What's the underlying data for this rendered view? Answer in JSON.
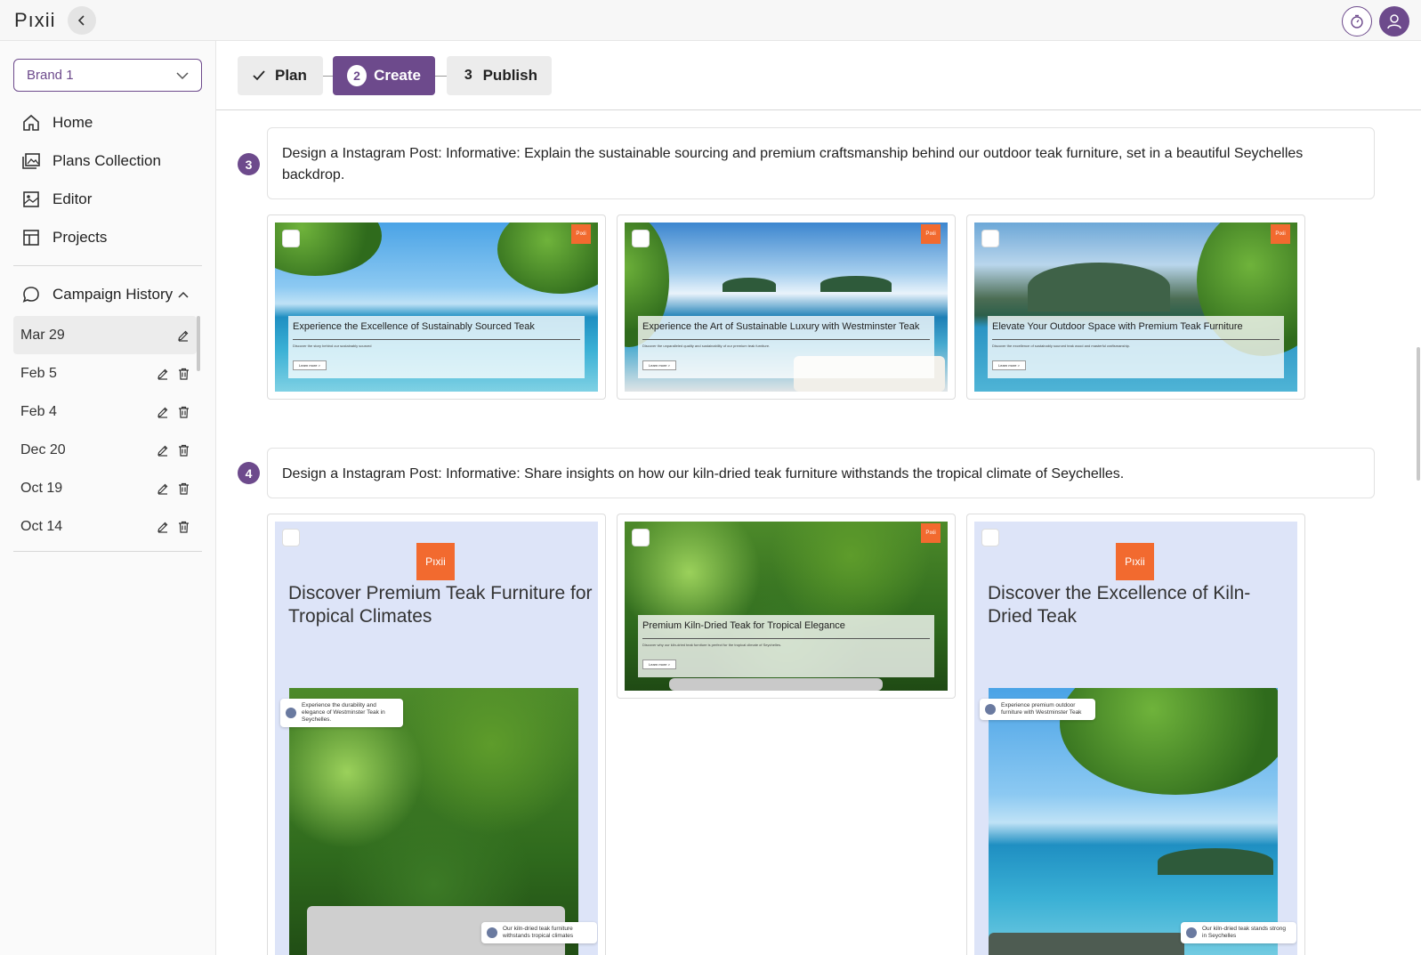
{
  "app": {
    "logo": "Pıxii"
  },
  "brand_select": {
    "value": "Brand 1"
  },
  "nav": [
    {
      "label": "Home",
      "icon": "home-icon"
    },
    {
      "label": "Plans Collection",
      "icon": "images-icon"
    },
    {
      "label": "Editor",
      "icon": "image-edit-icon"
    },
    {
      "label": "Projects",
      "icon": "layout-icon"
    }
  ],
  "history": {
    "title": "Campaign History",
    "items": [
      {
        "label": "Mar 29"
      },
      {
        "label": "Feb 5"
      },
      {
        "label": "Feb 4"
      },
      {
        "label": "Dec 20"
      },
      {
        "label": "Oct 19"
      },
      {
        "label": "Oct 14"
      }
    ]
  },
  "stepper": {
    "plan": "Plan",
    "create_num": "2",
    "create": "Create",
    "publish_num": "3",
    "publish": "Publish"
  },
  "rows": [
    {
      "num": "3",
      "prompt": "Design a Instagram Post: Informative: Explain the sustainable sourcing and premium craftsmanship behind our outdoor teak furniture, set in a beautiful Seychelles backdrop.",
      "cards": [
        {
          "tag": "Pıxii",
          "title": "Experience the Excellence of Sustainably Sourced Teak",
          "sub": "Discover the story behind our sustainably sourced",
          "btn": "Learn more >"
        },
        {
          "tag": "Pıxii",
          "title": "Experience the Art of Sustainable Luxury with Westminster Teak",
          "sub": "Discover the unparalleled quality and sustainability of our premium teak furniture.",
          "btn": "Learn more >"
        },
        {
          "tag": "Pıxii",
          "title": "Elevate Your Outdoor Space with Premium Teak Furniture",
          "sub": "Discover the excellence of sustainably sourced teak wood and masterful craftsmanship.",
          "btn": "Learn more >"
        }
      ]
    },
    {
      "num": "4",
      "prompt": "Design a Instagram Post: Informative: Share insights on how our kiln-dried teak furniture withstands the tropical climate of Seychelles.",
      "cards": [
        {
          "tag": "Pıxii",
          "title": "Discover Premium Teak Furniture for Tropical Climates",
          "bubble1": "Experience the durability and elegance of Westminster Teak in Seychelles.",
          "bubble2": "Our kiln-dried teak furniture withstands tropical climates"
        },
        {
          "tag": "Pıxii",
          "title": "Premium Kiln-Dried Teak for Tropical Elegance",
          "sub": "Discover why our kiln-dried teak furniture is perfect for the tropical climate of Seychelles.",
          "btn": "Learn more >"
        },
        {
          "tag": "Pıxii",
          "title": "Discover the Excellence of Kiln-Dried Teak",
          "bubble1": "Experience premium outdoor furniture with Westminster Teak",
          "bubble2": "Our kiln-dried teak stands strong in Seychelles"
        }
      ]
    }
  ],
  "colors": {
    "accent": "#6d4a8c",
    "pixii_orange": "#f26a2f"
  }
}
